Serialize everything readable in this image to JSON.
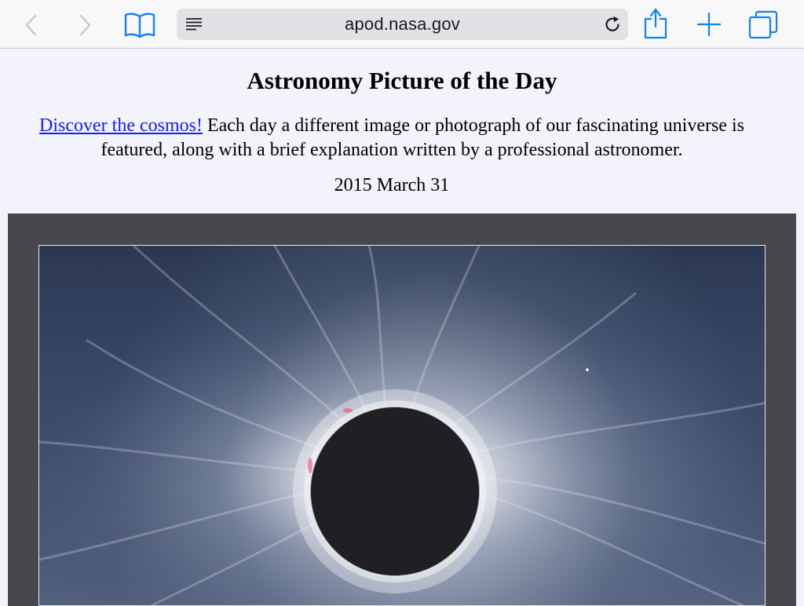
{
  "browser": {
    "url": "apod.nasa.gov"
  },
  "icons": {
    "back": "chevron-left-icon",
    "forward": "chevron-right-icon",
    "bookmarks": "book-icon",
    "reader": "reader-lines-icon",
    "reload": "reload-icon",
    "share": "share-icon",
    "new_tab": "plus-icon",
    "tabs": "tabs-icon"
  },
  "colors": {
    "accent": "#157efb",
    "disabled": "#c7c7cc",
    "link": "#1a1aff",
    "page_background": "#f3f3fb"
  },
  "page": {
    "title": "Astronomy Picture of the Day",
    "link_text": "Discover the cosmos!",
    "intro_text": " Each day a different image or photograph of our fascinating universe is featured, along with a brief explanation written by a professional astronomer.",
    "date": "2015 March 31"
  }
}
